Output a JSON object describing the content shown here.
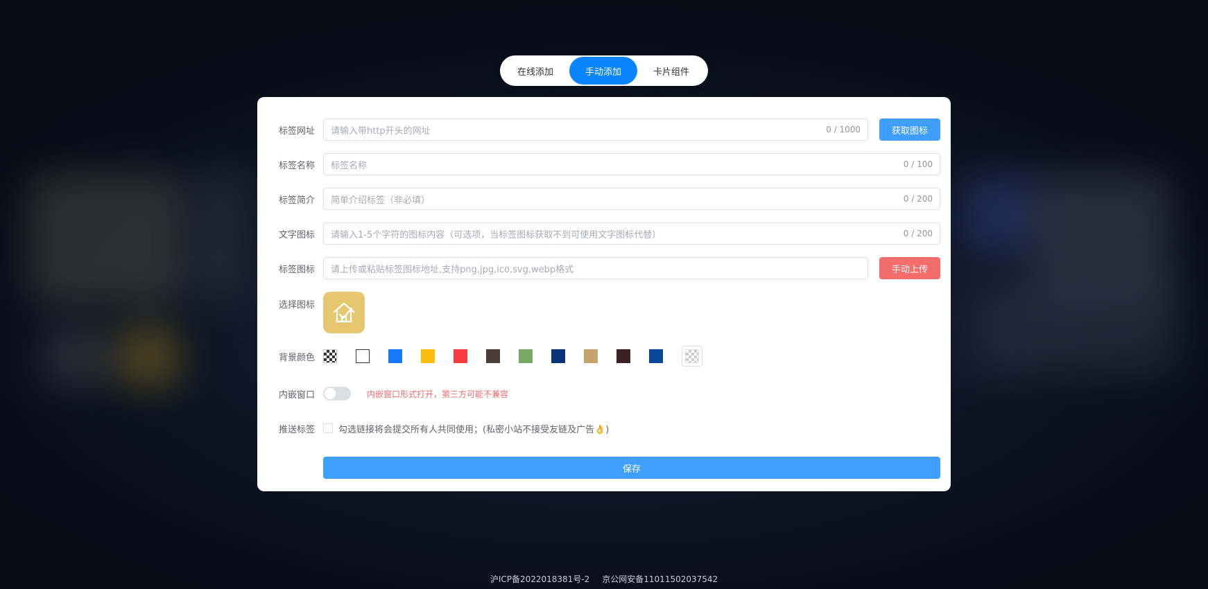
{
  "tabs": [
    {
      "label": "在线添加",
      "active": false
    },
    {
      "label": "手动添加",
      "active": true
    },
    {
      "label": "卡片组件",
      "active": false
    }
  ],
  "form": {
    "url": {
      "label": "标签网址",
      "placeholder": "请输入带http开头的网址",
      "count": "0 / 1000",
      "button": "获取图标"
    },
    "name": {
      "label": "标签名称",
      "placeholder": "标签名称",
      "count": "0 / 100"
    },
    "intro": {
      "label": "标签简介",
      "placeholder": "简单介绍标签（非必填）",
      "count": "0 / 200"
    },
    "text_icon": {
      "label": "文字图标",
      "placeholder": "请输入1-5个字符的图标内容（可选项，当标签图标获取不到可使用文字图标代替）",
      "count": "0 / 200"
    },
    "icon": {
      "label": "标签图标",
      "placeholder": "请上传或粘贴标签图标地址,支持png,jpg,ico,svg,webp格式",
      "button": "手动上传"
    },
    "select_icon": {
      "label": "选择图标",
      "icon_name": "house-check-icon",
      "bg": "#e6c66f"
    },
    "bg_color": {
      "label": "背景颜色",
      "colors": [
        "transparent",
        "#ffffff",
        "#1677ff",
        "#fbbd12",
        "#f5393d",
        "#4a3c36",
        "#79a764",
        "#0b3379",
        "#c4a46b",
        "#3a2124",
        "#0b4596"
      ]
    },
    "embed": {
      "label": "内嵌窗口",
      "hint": "内嵌窗口形式打开，第三方可能不兼容",
      "on": false
    },
    "push": {
      "label": "推送标签",
      "text": "勾选链接将会提交所有人共同使用；(私密小站不接受友链及广告👌)",
      "checked": false
    },
    "save": "保存"
  },
  "footer": {
    "icp": "沪ICP备2022018381号-2",
    "police": "京公网安备11011502037542"
  },
  "colors": {
    "primary": "#409eff",
    "tab_active": "#0b84ff",
    "danger": "#f56c6c"
  }
}
